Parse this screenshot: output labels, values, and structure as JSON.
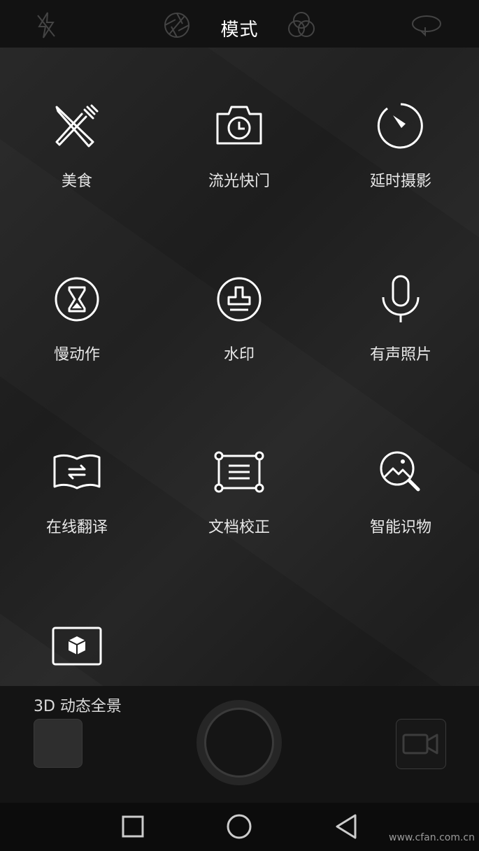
{
  "topbar": {
    "title": "模式",
    "icons": [
      "flash-off-icon",
      "aperture-icon",
      "filter-icon",
      "rotate-camera-icon"
    ]
  },
  "modes": [
    {
      "label": "美食",
      "icon": "fork-knife-icon"
    },
    {
      "label": "流光快门",
      "icon": "camera-timer-icon"
    },
    {
      "label": "延时摄影",
      "icon": "timelapse-icon"
    },
    {
      "label": "慢动作",
      "icon": "hourglass-icon"
    },
    {
      "label": "水印",
      "icon": "stamp-icon"
    },
    {
      "label": "有声照片",
      "icon": "microphone-icon"
    },
    {
      "label": "在线翻译",
      "icon": "book-translate-icon"
    },
    {
      "label": "文档校正",
      "icon": "document-correction-icon"
    },
    {
      "label": "智能识物",
      "icon": "image-search-icon"
    },
    {
      "label": "3D 动态全景",
      "icon": "cube-icon"
    }
  ],
  "bottom": {
    "gallery_thumb": "gallery-thumbnail",
    "shutter": "shutter-button",
    "video": "video-mode-icon"
  },
  "nav": [
    "recent-apps-icon",
    "home-icon",
    "back-icon"
  ],
  "watermark": "www.cfan.com.cn"
}
